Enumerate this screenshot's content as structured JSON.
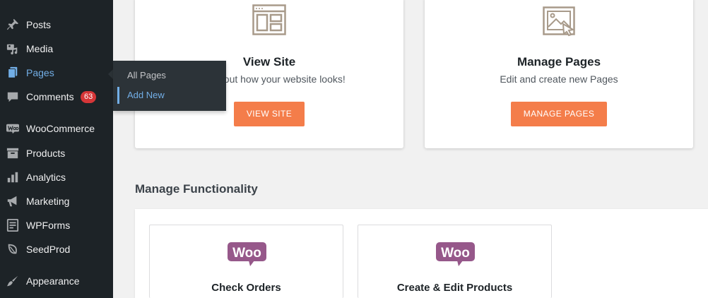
{
  "sidebar": {
    "items": [
      {
        "label": "Posts",
        "icon": "pushpin-icon"
      },
      {
        "label": "Media",
        "icon": "media-icon"
      },
      {
        "label": "Pages",
        "icon": "pages-icon",
        "current": true
      },
      {
        "label": "Comments",
        "icon": "comment-icon",
        "badge": "63"
      },
      {
        "label": "WooCommerce",
        "icon": "woo-icon"
      },
      {
        "label": "Products",
        "icon": "archive-icon"
      },
      {
        "label": "Analytics",
        "icon": "bar-chart-icon"
      },
      {
        "label": "Marketing",
        "icon": "megaphone-icon"
      },
      {
        "label": "WPForms",
        "icon": "form-icon"
      },
      {
        "label": "SeedProd",
        "icon": "leaf-icon"
      },
      {
        "label": "Appearance",
        "icon": "paintbrush-icon"
      }
    ]
  },
  "flyout": {
    "items": [
      {
        "label": "All Pages"
      },
      {
        "label": "Add New",
        "active": true
      }
    ]
  },
  "cards": [
    {
      "title": "View Site",
      "description": "Check out how your website looks!",
      "button": "VIEW SITE",
      "icon": "layout-icon"
    },
    {
      "title": "Manage Pages",
      "description": "Edit and create new Pages",
      "button": "MANAGE PAGES",
      "icon": "image-edit-icon"
    }
  ],
  "functionality": {
    "title": "Manage Functionality",
    "cards": [
      {
        "title": "Check Orders",
        "logo_text": "Woo",
        "icon": "woo-logo-icon"
      },
      {
        "title": "Create & Edit Products",
        "logo_text": "Woo",
        "icon": "woo-logo-icon"
      }
    ]
  },
  "colors": {
    "sidebar_bg": "#1d2327",
    "accent_blue": "#72aee6",
    "button_orange": "#f47d4a",
    "badge_red": "#d63638",
    "woo_purple": "#96588a",
    "icon_tan": "#a89a8a"
  }
}
